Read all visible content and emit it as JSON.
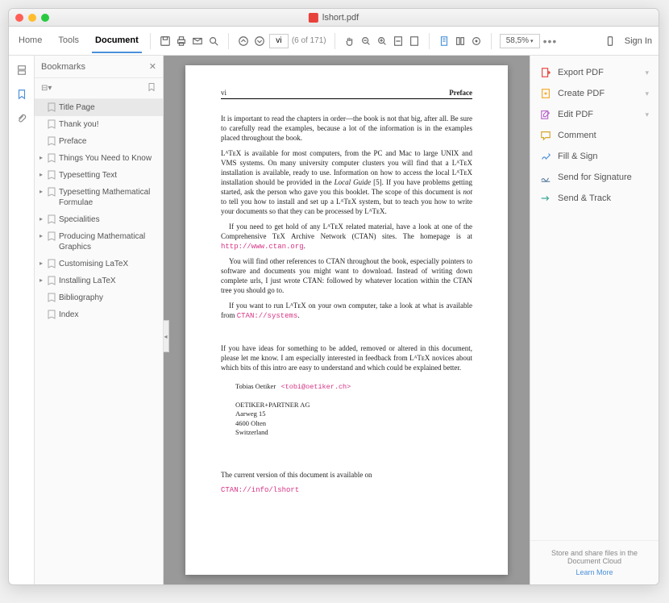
{
  "window": {
    "title": "lshort.pdf"
  },
  "tabs": {
    "home": "Home",
    "tools": "Tools",
    "document": "Document"
  },
  "toolbar": {
    "page_current": "vi",
    "page_count_label": "(6 of 171)",
    "zoom_value": "58,5%"
  },
  "signin": "Sign In",
  "bookmarks": {
    "title": "Bookmarks",
    "items": [
      {
        "label": "Title Page",
        "expandable": false,
        "selected": true
      },
      {
        "label": "Thank you!",
        "expandable": false,
        "selected": false
      },
      {
        "label": "Preface",
        "expandable": false,
        "selected": false
      },
      {
        "label": "Things You Need to Know",
        "expandable": true,
        "selected": false
      },
      {
        "label": "Typesetting Text",
        "expandable": true,
        "selected": false
      },
      {
        "label": "Typesetting Mathematical Formulae",
        "expandable": true,
        "selected": false
      },
      {
        "label": "Specialities",
        "expandable": true,
        "selected": false
      },
      {
        "label": "Producing Mathematical Graphics",
        "expandable": true,
        "selected": false
      },
      {
        "label": "Customising LaTeX",
        "expandable": true,
        "selected": false
      },
      {
        "label": "Installing LaTeX",
        "expandable": true,
        "selected": false
      },
      {
        "label": "Bibliography",
        "expandable": false,
        "selected": false
      },
      {
        "label": "Index",
        "expandable": false,
        "selected": false
      }
    ]
  },
  "rpanel": {
    "items": [
      {
        "label": "Export PDF",
        "chev": true,
        "color": "ic-red"
      },
      {
        "label": "Create PDF",
        "chev": true,
        "color": "ic-orange"
      },
      {
        "label": "Edit PDF",
        "chev": true,
        "color": "ic-purple"
      },
      {
        "label": "Comment",
        "chev": false,
        "color": "ic-yellow"
      },
      {
        "label": "Fill & Sign",
        "chev": false,
        "color": "ic-blue"
      },
      {
        "label": "Send for Signature",
        "chev": false,
        "color": "ic-navy"
      },
      {
        "label": "Send & Track",
        "chev": false,
        "color": "ic-teal"
      }
    ],
    "bottom_text": "Store and share files in the Document Cloud",
    "learn_more": "Learn More"
  },
  "page": {
    "num": "vi",
    "section": "Preface",
    "p1a": "It is important to read the chapters in order—the book is not that big, after all. Be sure to carefully read the examples, because a lot of the information is in the examples placed throughout the book.",
    "p2a": "LᴬTᴇX is available for most computers, from the PC and Mac to large UNIX and VMS systems. On many university computer clusters you will find that a LᴬTᴇX installation is available, ready to use. Information on how to access the local LᴬTᴇX installation should be provided in the ",
    "p2b": "Local Guide",
    "p2c": " [5]. If you have problems getting started, ask the person who gave you this booklet. The scope of this document is ",
    "p2d": "not",
    "p2e": " to tell you how to install and set up a LᴬTᴇX system, but to teach you how to write your documents so that they can be processed by LᴬTᴇX.",
    "p3a": "If you need to get hold of any LᴬTᴇX related material, have a look at one of the Comprehensive TᴇX Archive Network (CTAN) sites. The homepage is at ",
    "p3link": "http://www.ctan.org",
    "p3b": ".",
    "p4": "You will find other references to CTAN throughout the book, especially pointers to software and documents you might want to download. Instead of writing down complete urls, I just wrote CTAN: followed by whatever location within the CTAN tree you should go to.",
    "p5a": "If you want to run LᴬTᴇX on your own computer, take a look at what is available from ",
    "p5link": "CTAN://systems",
    "p5b": ".",
    "p6": "If you have ideas for something to be added, removed or altered in this document, please let me know. I am especially interested in feedback from LᴬTᴇX novices about which bits of this intro are easy to understand and which could be explained better.",
    "author": "Tobias Oetiker",
    "email": "<tobi@oetiker.ch>",
    "addr1": "OETIKER+PARTNER AG",
    "addr2": "Aarweg 15",
    "addr3": "4600 Olten",
    "addr4": "Switzerland",
    "footer_text": "The current version of this document is available on",
    "footer_link": "CTAN://info/lshort"
  }
}
